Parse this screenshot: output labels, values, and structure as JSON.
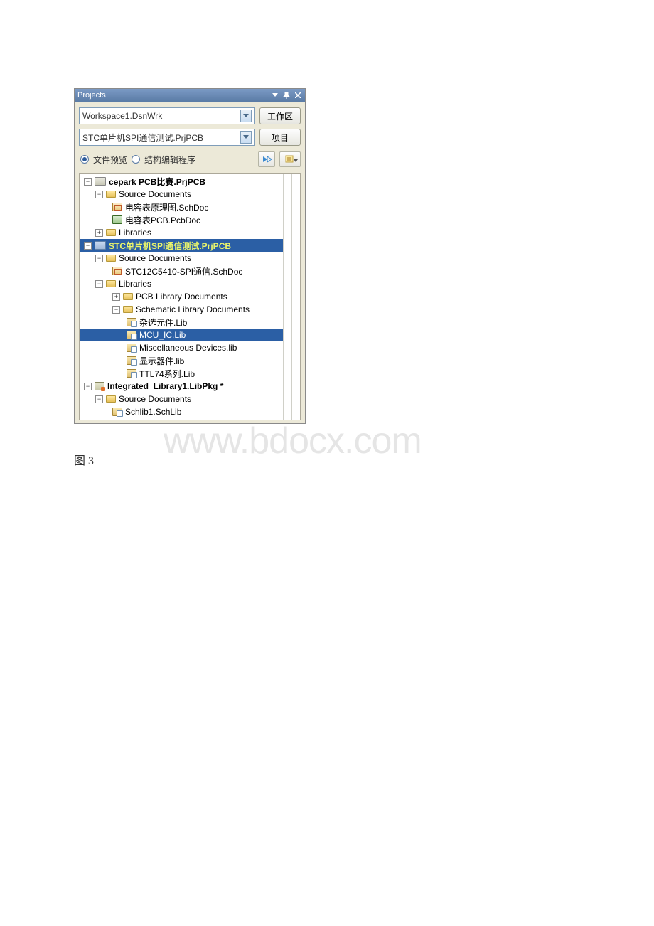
{
  "panel": {
    "title": "Projects",
    "workspace_value": "Workspace1.DsnWrk",
    "workspace_btn": "工作区",
    "project_value": "STC单片机SPI通信测试.PrjPCB",
    "project_btn": "项目",
    "radio_preview": "文件预览",
    "radio_struct": "结构编辑程序"
  },
  "tree": {
    "p1": {
      "label": "cepark PCB比赛.PrjPCB",
      "src": "Source Documents",
      "f1": "电容表原理图.SchDoc",
      "f2": "电容表PCB.PcbDoc",
      "libs": "Libraries"
    },
    "p2": {
      "label": "STC单片机SPI通信测试.PrjPCB",
      "src": "Source Documents",
      "f1": "STC12C5410-SPI通信.SchDoc",
      "libs": "Libraries",
      "pcb_lib": "PCB Library Documents",
      "sch_lib": "Schematic Library Documents",
      "l1": "杂选元件.Lib",
      "l2": "MCU_IC.Lib",
      "l3": "Miscellaneous Devices.lib",
      "l4": "显示器件.lib",
      "l5": "TTL74系列.Lib"
    },
    "p3": {
      "label": "Integrated_Library1.LibPkg *",
      "src": "Source Documents",
      "f1": "Schlib1.SchLib"
    }
  },
  "caption": "图 3",
  "watermark": "www.bdocx.com"
}
